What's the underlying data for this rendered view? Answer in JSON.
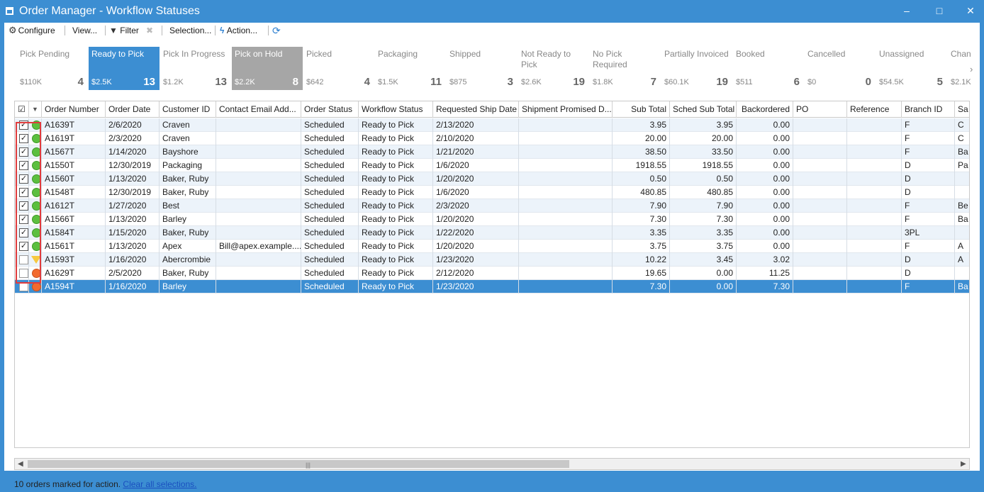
{
  "window": {
    "title": "Order Manager - Workflow Statuses",
    "controls": {
      "minimize": "–",
      "maximize": "□",
      "close": "✕"
    }
  },
  "toolbar": {
    "configure": "Configure",
    "view": "View...",
    "filter": "Filter",
    "clear_filter": "✖",
    "selection": "Selection...",
    "action": "Action...",
    "refresh": "⟳"
  },
  "status_tiles": [
    {
      "name": "Pick Pending",
      "amount": "$110K",
      "count": "4",
      "state": "normal"
    },
    {
      "name": "Ready to Pick",
      "amount": "$2.5K",
      "count": "13",
      "state": "active"
    },
    {
      "name": "Pick In Progress",
      "amount": "$1.2K",
      "count": "13",
      "state": "normal"
    },
    {
      "name": "Pick on Hold",
      "amount": "$2.2K",
      "count": "8",
      "state": "hold"
    },
    {
      "name": "Picked",
      "amount": "$642",
      "count": "4",
      "state": "normal"
    },
    {
      "name": "Packaging",
      "amount": "$1.5K",
      "count": "11",
      "state": "normal"
    },
    {
      "name": "Shipped",
      "amount": "$875",
      "count": "3",
      "state": "normal"
    },
    {
      "name": "Not Ready to Pick",
      "amount": "$2.6K",
      "count": "19",
      "state": "normal"
    },
    {
      "name": "No Pick Required",
      "amount": "$1.8K",
      "count": "7",
      "state": "normal"
    },
    {
      "name": "Partially Invoiced",
      "amount": "$60.1K",
      "count": "19",
      "state": "normal"
    },
    {
      "name": "Booked",
      "amount": "$511",
      "count": "6",
      "state": "normal"
    },
    {
      "name": "Cancelled",
      "amount": "$0",
      "count": "0",
      "state": "normal"
    },
    {
      "name": "Unassigned",
      "amount": "$54.5K",
      "count": "5",
      "state": "normal"
    },
    {
      "name": "Chan",
      "amount": "$2.1K",
      "count": "",
      "state": "normal"
    }
  ],
  "strip_next": "›",
  "grid": {
    "header_check": "☑",
    "columns": [
      "Order Number",
      "Order Date",
      "Customer ID",
      "Contact Email Add...",
      "Order Status",
      "Workflow Status",
      "Requested Ship Date",
      "Shipment Promised D...",
      "Sub Total",
      "Sched Sub Total",
      "Backordered",
      "PO",
      "Reference",
      "Branch ID",
      "Sa"
    ],
    "rows": [
      {
        "checked": true,
        "indicator": "green",
        "cells": [
          "A1639T",
          "2/6/2020",
          "Craven",
          "",
          "Scheduled",
          "Ready to Pick",
          "2/13/2020",
          "",
          "3.95",
          "3.95",
          "0.00",
          "",
          "",
          "F",
          "C"
        ]
      },
      {
        "checked": true,
        "indicator": "green",
        "cells": [
          "A1619T",
          "2/3/2020",
          "Craven",
          "",
          "Scheduled",
          "Ready to Pick",
          "2/10/2020",
          "",
          "20.00",
          "20.00",
          "0.00",
          "",
          "",
          "F",
          "C"
        ]
      },
      {
        "checked": true,
        "indicator": "green",
        "cells": [
          "A1567T",
          "1/14/2020",
          "Bayshore",
          "",
          "Scheduled",
          "Ready to Pick",
          "1/21/2020",
          "",
          "38.50",
          "33.50",
          "0.00",
          "",
          "",
          "F",
          "Ba"
        ]
      },
      {
        "checked": true,
        "indicator": "green",
        "cells": [
          "A1550T",
          "12/30/2019",
          "Packaging",
          "",
          "Scheduled",
          "Ready to Pick",
          "1/6/2020",
          "",
          "1918.55",
          "1918.55",
          "0.00",
          "",
          "",
          "D",
          "Pa"
        ]
      },
      {
        "checked": true,
        "indicator": "green",
        "cells": [
          "A1560T",
          "1/13/2020",
          "Baker, Ruby",
          "",
          "Scheduled",
          "Ready to Pick",
          "1/20/2020",
          "",
          "0.50",
          "0.50",
          "0.00",
          "",
          "",
          "D",
          ""
        ]
      },
      {
        "checked": true,
        "indicator": "green",
        "cells": [
          "A1548T",
          "12/30/2019",
          "Baker, Ruby",
          "",
          "Scheduled",
          "Ready to Pick",
          "1/6/2020",
          "",
          "480.85",
          "480.85",
          "0.00",
          "",
          "",
          "D",
          ""
        ]
      },
      {
        "checked": true,
        "indicator": "green",
        "cells": [
          "A1612T",
          "1/27/2020",
          "Best",
          "",
          "Scheduled",
          "Ready to Pick",
          "2/3/2020",
          "",
          "7.90",
          "7.90",
          "0.00",
          "",
          "",
          "F",
          "Be"
        ]
      },
      {
        "checked": true,
        "indicator": "green",
        "cells": [
          "A1566T",
          "1/13/2020",
          "Barley",
          "",
          "Scheduled",
          "Ready to Pick",
          "1/20/2020",
          "",
          "7.30",
          "7.30",
          "0.00",
          "",
          "",
          "F",
          "Ba"
        ]
      },
      {
        "checked": true,
        "indicator": "green",
        "cells": [
          "A1584T",
          "1/15/2020",
          "Baker, Ruby",
          "",
          "Scheduled",
          "Ready to Pick",
          "1/22/2020",
          "",
          "3.35",
          "3.35",
          "0.00",
          "",
          "",
          "3PL",
          ""
        ]
      },
      {
        "checked": true,
        "indicator": "green",
        "cells": [
          "A1561T",
          "1/13/2020",
          "Apex",
          "Bill@apex.example....",
          "Scheduled",
          "Ready to Pick",
          "1/20/2020",
          "",
          "3.75",
          "3.75",
          "0.00",
          "",
          "",
          "F",
          "A"
        ]
      },
      {
        "checked": false,
        "indicator": "yellow",
        "cells": [
          "A1593T",
          "1/16/2020",
          "Abercrombie",
          "",
          "Scheduled",
          "Ready to Pick",
          "1/23/2020",
          "",
          "10.22",
          "3.45",
          "3.02",
          "",
          "",
          "D",
          "A"
        ]
      },
      {
        "checked": false,
        "indicator": "orange",
        "cells": [
          "A1629T",
          "2/5/2020",
          "Baker, Ruby",
          "",
          "Scheduled",
          "Ready to Pick",
          "2/12/2020",
          "",
          "19.65",
          "0.00",
          "11.25",
          "",
          "",
          "D",
          ""
        ]
      },
      {
        "checked": false,
        "indicator": "orange",
        "selected": true,
        "cells": [
          "A1594T",
          "1/16/2020",
          "Barley",
          "",
          "Scheduled",
          "Ready to Pick",
          "1/23/2020",
          "",
          "7.30",
          "0.00",
          "7.30",
          "",
          "",
          "F",
          "Ba"
        ]
      }
    ]
  },
  "scrollbar": {
    "left": "◀",
    "right": "▶",
    "grip": "|||"
  },
  "status": {
    "marked": "10 orders marked for action.",
    "clear_link": "Clear all selections."
  }
}
